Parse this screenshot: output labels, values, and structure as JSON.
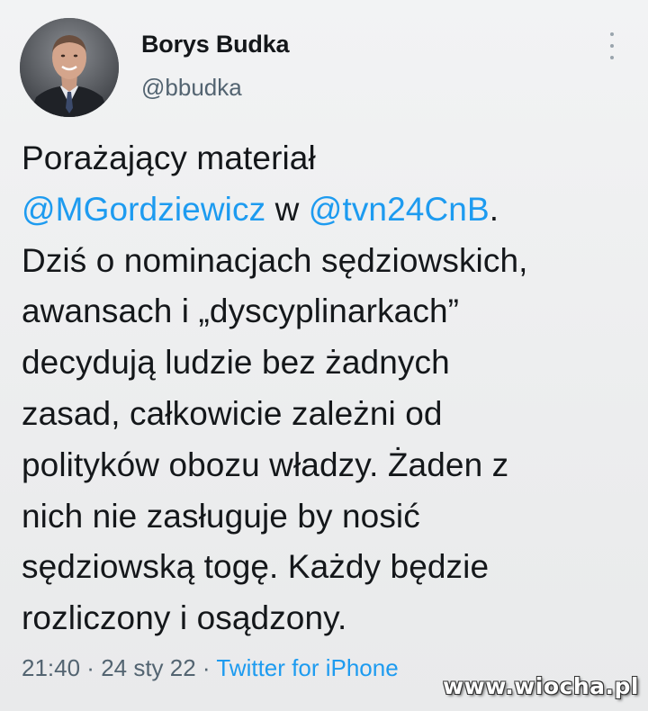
{
  "author": {
    "name": "Borys Budka",
    "handle": "@bbudka"
  },
  "tweet": {
    "lines": [
      [
        {
          "t": "Porażający materiał",
          "m": false
        }
      ],
      [
        {
          "t": "@MGordziewicz",
          "m": true
        },
        {
          "t": " w ",
          "m": false
        },
        {
          "t": "@tvn24CnB",
          "m": true
        },
        {
          "t": ".",
          "m": false
        }
      ],
      [
        {
          "t": "Dziś o nominacjach sędziowskich,",
          "m": false
        }
      ],
      [
        {
          "t": "awansach i „dyscyplinarkach”",
          "m": false
        }
      ],
      [
        {
          "t": "decydują ludzie bez żadnych",
          "m": false
        }
      ],
      [
        {
          "t": "zasad, całkowicie zależni od",
          "m": false
        }
      ],
      [
        {
          "t": "polityków obozu władzy. Żaden z",
          "m": false
        }
      ],
      [
        {
          "t": "nich nie zasługuje by nosić",
          "m": false
        }
      ],
      [
        {
          "t": "sędziowską togę. Każdy będzie",
          "m": false
        }
      ],
      [
        {
          "t": "rozliczony i osądzony.",
          "m": false
        }
      ]
    ]
  },
  "meta": {
    "time": "21:40",
    "separator": " · ",
    "date": "24 sty 22",
    "source": "Twitter for iPhone"
  },
  "watermark": "www.wiocha.pl",
  "icons": {
    "more": "more-vertical-icon"
  },
  "colors": {
    "link": "#1d9bf0",
    "text": "#14171a",
    "secondary": "#536471"
  }
}
